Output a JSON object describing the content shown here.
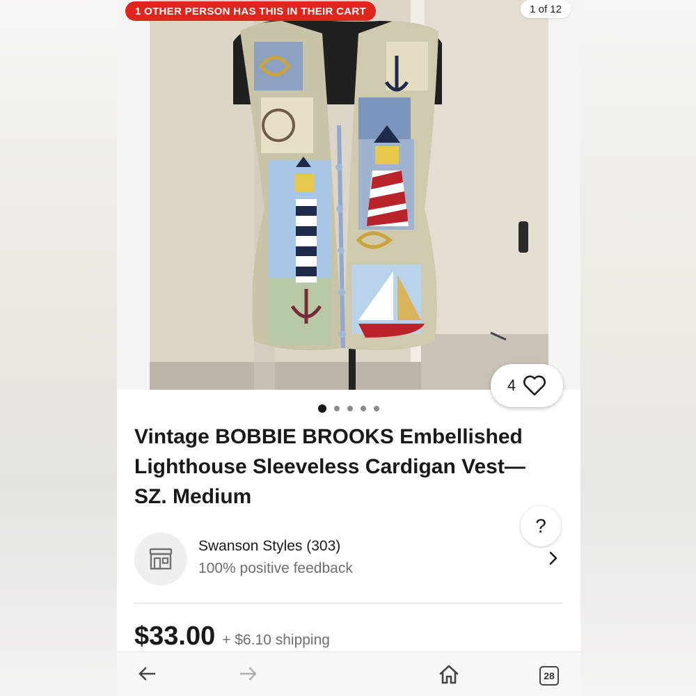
{
  "listing": {
    "cart_banner": "1 OTHER PERSON HAS THIS IN THEIR CART",
    "image_counter": "1 of 12",
    "watch_count": "4",
    "image_dots": 5,
    "active_dot": 1,
    "title": "Vintage BOBBIE BROOKS Embellished Lighthouse Sleeveless Cardigan Vest— SZ. Medium",
    "help_label": "?"
  },
  "seller": {
    "name": "Swanson Styles (303)",
    "feedback": "100% positive feedback"
  },
  "pricing": {
    "price": "$33.00",
    "shipping": "+ $6.10 shipping"
  },
  "bottom_nav": {
    "tabs_count": "28",
    "icons": [
      "back-arrow-icon",
      "forward-arrow-icon",
      "home-icon",
      "tabs-icon"
    ]
  },
  "colors": {
    "banner_red": "#e0261c",
    "text_primary": "#191919",
    "text_secondary": "#6e6e6e"
  }
}
